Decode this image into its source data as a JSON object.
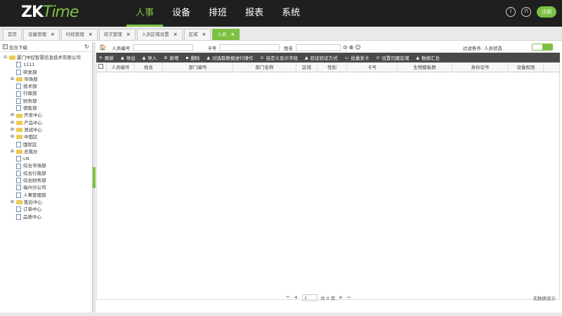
{
  "app": {
    "logo_main": "ZK",
    "logo_accent": "Time",
    "logout": "注销"
  },
  "nav": [
    {
      "label": "人事",
      "active": true
    },
    {
      "label": "设备"
    },
    {
      "label": "排班"
    },
    {
      "label": "报表"
    },
    {
      "label": "系统"
    }
  ],
  "tabs": [
    {
      "label": "首页",
      "closable": false
    },
    {
      "label": "设备管理",
      "closable": true
    },
    {
      "label": "时段管理",
      "closable": true
    },
    {
      "label": "班次管理",
      "closable": true
    },
    {
      "label": "人员区域设置",
      "closable": true
    },
    {
      "label": "区域",
      "closable": true
    },
    {
      "label": "人员",
      "closable": true,
      "active": true
    }
  ],
  "left": {
    "include_sub_label": "包含下级"
  },
  "tree": [
    {
      "label": "厦门中控智慧信息技术有限公司",
      "level": 0,
      "type": "folder",
      "toggle": "⊟"
    },
    {
      "label": "1111",
      "level": 1,
      "type": "file"
    },
    {
      "label": "研发部",
      "level": 1,
      "type": "file"
    },
    {
      "label": "市场部",
      "level": 1,
      "type": "folder",
      "toggle": "⊞"
    },
    {
      "label": "技术部",
      "level": 1,
      "type": "file"
    },
    {
      "label": "行政部",
      "level": 1,
      "type": "file"
    },
    {
      "label": "财务部",
      "level": 1,
      "type": "file"
    },
    {
      "label": "销售部",
      "level": 1,
      "type": "file"
    },
    {
      "label": "开发中心",
      "level": 1,
      "type": "folder",
      "toggle": "⊞"
    },
    {
      "label": "产品中心",
      "level": 1,
      "type": "folder",
      "toggle": "⊞"
    },
    {
      "label": "测试中心",
      "level": 1,
      "type": "folder",
      "toggle": "⊞"
    },
    {
      "label": "中国区",
      "level": 1,
      "type": "folder",
      "toggle": "⊞"
    },
    {
      "label": "国际区",
      "level": 1,
      "type": "file"
    },
    {
      "label": "总裁办",
      "level": 1,
      "type": "folder",
      "toggle": "⊞"
    },
    {
      "label": "LN",
      "level": 1,
      "type": "file"
    },
    {
      "label": "综合市场部",
      "level": 1,
      "type": "file"
    },
    {
      "label": "综合行政部",
      "level": 1,
      "type": "file"
    },
    {
      "label": "综合财务部",
      "level": 1,
      "type": "file"
    },
    {
      "label": "福州分公司",
      "level": 1,
      "type": "file"
    },
    {
      "label": "人事管理部",
      "level": 1,
      "type": "file"
    },
    {
      "label": "售后中心",
      "level": 1,
      "type": "folder",
      "toggle": "⊞"
    },
    {
      "label": "订单中心",
      "level": 1,
      "type": "file"
    },
    {
      "label": "品质中心",
      "level": 1,
      "type": "file"
    }
  ],
  "filter": {
    "emp_no_label": "人员编号",
    "card_label": "卡号",
    "name_label": "姓名",
    "condition_label": "过滤条件: 人员状态"
  },
  "toolbar": [
    {
      "icon": "↻",
      "label": "刷新",
      "name": "refresh"
    },
    {
      "icon": "▲",
      "label": "导出",
      "name": "export"
    },
    {
      "icon": "▲",
      "label": "导入",
      "name": "import"
    },
    {
      "icon": "⊕",
      "label": "新增",
      "name": "add"
    },
    {
      "icon": "▪",
      "label": "删除",
      "name": "delete"
    },
    {
      "icon": "▲",
      "label": "对选取数据进行操作",
      "name": "batch-op"
    },
    {
      "icon": "⊙",
      "label": "自定义显示字段",
      "name": "custom-fields"
    },
    {
      "icon": "▲",
      "label": "验证验证方式",
      "name": "verify-mode"
    },
    {
      "icon": "▭",
      "label": "批量发卡",
      "name": "batch-card"
    },
    {
      "icon": "⊙",
      "label": "设置归属区域",
      "name": "set-area"
    },
    {
      "icon": "▲",
      "label": "数据汇总",
      "name": "data-summary"
    }
  ],
  "columns": [
    "人员编号",
    "姓名",
    "部门编号",
    "部门名称",
    "区域",
    "性别",
    "卡号",
    "生物模板数",
    "身份证号",
    "设备权限"
  ],
  "pager": {
    "first": "⏮",
    "prev": "◀",
    "page": "1",
    "total": "共 0 页",
    "next": "▶",
    "last": "⏭",
    "no_data": "无数据显示"
  }
}
